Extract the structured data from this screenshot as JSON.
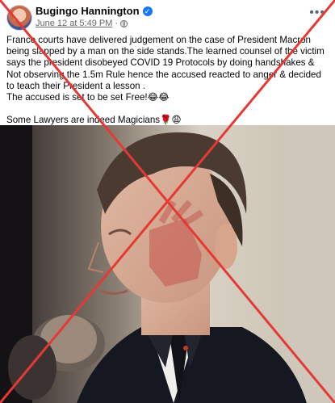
{
  "post": {
    "author": "Bugingo Hannington",
    "timestamp": "June 12 at 5:49 PM",
    "separator": "·",
    "more_icon": "•••",
    "verified_icon": "✓",
    "text_lines": [
      "France courts  have delivered judgement on the case of President Macron being slapped by a man on the side stands.The learned counsel of the victim says the president disobeyed COVID 19 Protocols by doing handshakes & Not observing the 1.5m Rule  hence the accused reacted to anger & decided  to teach their President a lesson .",
      "The accused is set to be set Free!😂😂",
      "Some Lawyers are indeed Magicians🌹😩"
    ]
  },
  "overlay": {
    "color": "#e53935"
  }
}
